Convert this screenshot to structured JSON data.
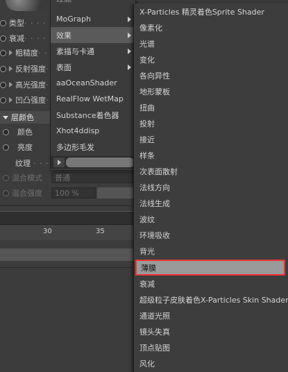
{
  "left_panel": {
    "rows": [
      {
        "label": "类型",
        "dots": "· · · · · ·"
      },
      {
        "label": "衰减",
        "dots": "· · · · · ·"
      },
      {
        "label": "粗糙度",
        "dots": "· · · ·"
      },
      {
        "label": "反射强度",
        "dots": "· ·"
      },
      {
        "label": "高光强度",
        "dots": "· ·"
      },
      {
        "label": "凹凸强度",
        "dots": "· ·"
      }
    ],
    "section_title": "层颜色",
    "color_label": "颜色",
    "brightness_label": "亮度",
    "texture_label": "纹理",
    "blend_mode_label": "混合模式",
    "blend_mode_value": "普通",
    "blend_strength_label": "混合强度",
    "blend_strength_value": "100 %",
    "ruler_ticks": [
      "30",
      "35"
    ]
  },
  "menu1": {
    "top_partial": "过滤",
    "items": [
      {
        "label": "MoGraph",
        "has_submenu": true
      },
      {
        "label": "效果",
        "has_submenu": true,
        "active": true
      },
      {
        "label": "素描与卡通",
        "has_submenu": true
      },
      {
        "label": "表面",
        "has_submenu": true
      },
      {
        "label": "aaOceanShader",
        "has_submenu": false
      },
      {
        "label": "RealFlow WetMap",
        "has_submenu": false
      },
      {
        "label": "Substance着色器",
        "has_submenu": false
      },
      {
        "label": "Xhot4ddisp",
        "has_submenu": false
      },
      {
        "label": "多边形毛发",
        "has_submenu": false
      }
    ]
  },
  "menu2": {
    "items": [
      "X-Particles 精灵着色Sprite Shader",
      "像素化",
      "光谱",
      "变化",
      "各向异性",
      "地形蒙板",
      "扭曲",
      "投射",
      "接近",
      "样条",
      "次表面散射",
      "法线方向",
      "法线生成",
      "波纹",
      "环境吸收",
      "背光",
      "薄膜",
      "衰减",
      "超级粒子皮肤着色X-Particles Skin Shader",
      "通道光照",
      "镜头失真",
      "顶点贴图",
      "风化"
    ],
    "highlighted": "薄膜"
  }
}
